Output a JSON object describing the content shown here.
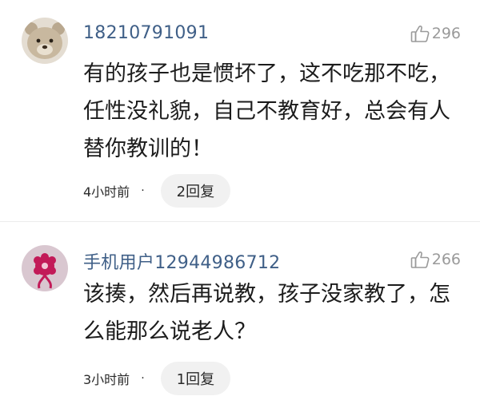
{
  "comments": [
    {
      "username": "18210791091",
      "likes": "296",
      "content": "有的孩子也是惯坏了，这不吃那不吃，任性没礼貌，自己不教育好，总会有人替你教训的！",
      "time": "4小时前",
      "dot": "·",
      "replies": "2回复",
      "avatar_icon": "teddy-bear-avatar"
    },
    {
      "username": "手机用户12944986712",
      "likes": "266",
      "content": "该揍，然后再说教，孩子没家教了，怎么能那么说老人？",
      "time": "3小时前",
      "dot": "·",
      "replies": "1回复",
      "avatar_icon": "red-flower-avatar"
    }
  ],
  "colors": {
    "username": "#3f5f87",
    "meta_gray": "#9a9a9a",
    "reply_bg": "#f1f1f1",
    "avatar2_bg": "#d9c7d0",
    "avatar2_flower": "#c21a58"
  }
}
